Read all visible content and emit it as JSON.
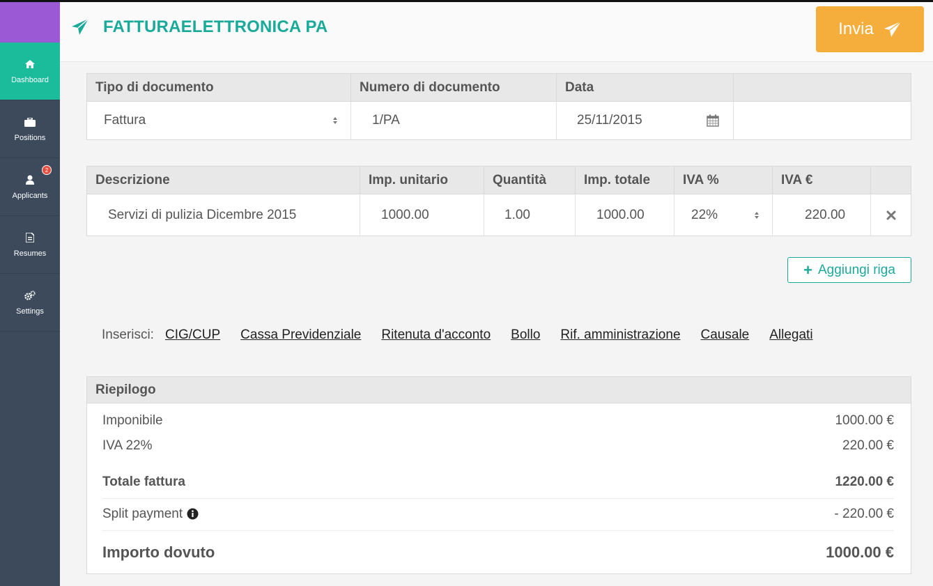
{
  "app": {
    "title": "FATTURAELETTRONICA PA",
    "send_label": "Invia"
  },
  "sidebar": {
    "items": [
      {
        "label": "Dashboard",
        "icon": "home-icon",
        "active": true
      },
      {
        "label": "Positions",
        "icon": "briefcase-icon"
      },
      {
        "label": "Applicants",
        "icon": "user-icon",
        "badge": "2"
      },
      {
        "label": "Resumes",
        "icon": "document-icon"
      },
      {
        "label": "Settings",
        "icon": "cogs-icon"
      }
    ]
  },
  "document": {
    "headers": [
      "Tipo di documento",
      "Numero di documento",
      "Data",
      ""
    ],
    "type_value": "Fattura",
    "number_value": "1/PA",
    "date_value": "25/11/2015"
  },
  "lines": {
    "headers": [
      "Descrizione",
      "Imp. unitario",
      "Quantità",
      "Imp. totale",
      "IVA %",
      "IVA €",
      ""
    ],
    "rows": [
      {
        "description": "Servizi di pulizia Dicembre 2015",
        "unit_price": "1000.00",
        "quantity": "1.00",
        "total": "1000.00",
        "vat_percent": "22%",
        "vat_amount": "220.00"
      }
    ],
    "add_row_label": "Aggiungi riga"
  },
  "insert": {
    "label": "Inserisci:",
    "links": [
      "CIG/CUP",
      "Cassa Previdenziale",
      "Ritenuta d'acconto",
      "Bollo",
      "Rif. amministrazione",
      "Causale",
      "Allegati"
    ]
  },
  "summary": {
    "title": "Riepilogo",
    "imponibile_label": "Imponibile",
    "imponibile_value": "1000.00 €",
    "iva_label": "IVA 22%",
    "iva_value": "220.00 €",
    "totale_label": "Totale fattura",
    "totale_value": "1220.00 €",
    "split_label": "Split payment",
    "split_value": "- 220.00 €",
    "dovuto_label": "Importo dovuto",
    "dovuto_value": "1000.00 €"
  },
  "colors": {
    "accent": "#1aaa9a",
    "send_button": "#f5ad3b",
    "sidebar": "#3d4a5c",
    "sidebar_active": "#1abc9c",
    "brand_purple": "#9b59d6",
    "amount_red": "#7b1e2a"
  }
}
